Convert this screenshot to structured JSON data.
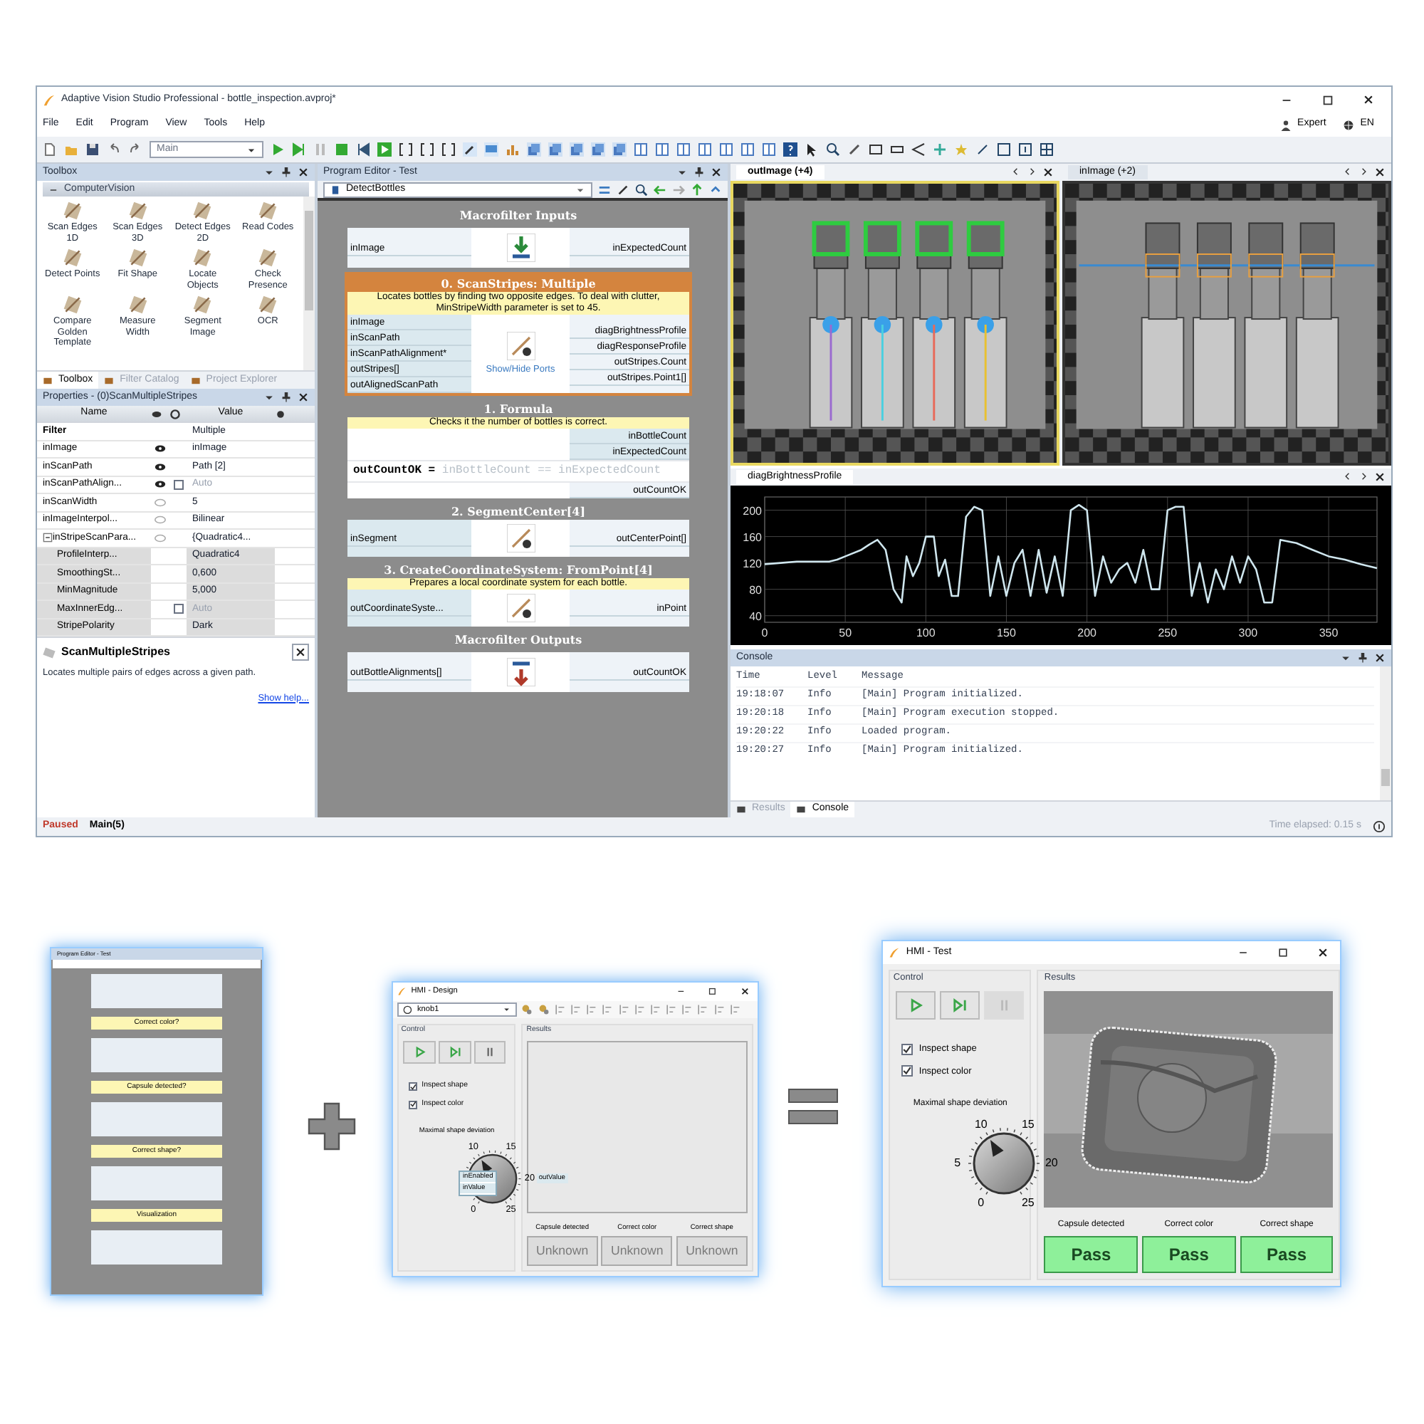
{
  "window": {
    "title": "Adaptive Vision Studio Professional - bottle_inspection.avproj*"
  },
  "menu": [
    "File",
    "Edit",
    "Program",
    "View",
    "Tools",
    "Help"
  ],
  "menu_right": [
    "Expert",
    "EN"
  ],
  "toolbar": {
    "program_select": "Main"
  },
  "toolbox": {
    "title": "Toolbox",
    "category": "ComputerVision",
    "items": [
      "Scan Edges 1D",
      "Scan Edges 3D",
      "Detect Edges 2D",
      "Read Codes",
      "Detect Points",
      "Fit Shape",
      "Locate Objects",
      "Check Presence",
      "Compare Golden Template",
      "Measure Width",
      "Segment Image",
      "OCR"
    ],
    "tabs": [
      {
        "label": "Toolbox",
        "selected": true
      },
      {
        "label": "Filter Catalog",
        "selected": false
      },
      {
        "label": "Project Explorer",
        "selected": false
      }
    ]
  },
  "properties": {
    "title": "Properties - (0)ScanMultipleStripes",
    "columns": [
      "Name",
      "Value"
    ],
    "rows": [
      {
        "name": "Filter",
        "value": "Multiple"
      },
      {
        "name": "inImage",
        "visible": true,
        "value": "inImage"
      },
      {
        "name": "inScanPath",
        "visible": true,
        "value": "Path [2]"
      },
      {
        "name": "inScanPathAlign...",
        "visible": true,
        "checked": false,
        "value": "Auto",
        "disabled": true
      },
      {
        "name": "inScanWidth",
        "visible": false,
        "value": "5"
      },
      {
        "name": "inImageInterpol...",
        "visible": false,
        "value": "Bilinear"
      },
      {
        "name": "inStripeScanPara...",
        "visible": false,
        "value": "{Quadratic4...",
        "expanded": true,
        "children": [
          {
            "name": "ProfileInterp...",
            "value": "Quadratic4"
          },
          {
            "name": "SmoothingSt...",
            "value": "0,600"
          },
          {
            "name": "MinMagnitude",
            "value": "5,000"
          },
          {
            "name": "MaxInnerEdg...",
            "checked": false,
            "value": "Auto",
            "disabled": true
          },
          {
            "name": "StripePolarity",
            "value": "Dark"
          }
        ]
      }
    ]
  },
  "help": {
    "title": "ScanMultipleStripes",
    "text": "Locates multiple pairs of edges across a given path.",
    "link": "Show help..."
  },
  "program_editor": {
    "title": "Program Editor - Test",
    "macrofilter": "DetectBottles",
    "blocks": [
      {
        "kind": "inputs",
        "title": "Macrofilter Inputs",
        "left": [
          "inImage"
        ],
        "right": [
          "inExpectedCount"
        ]
      },
      {
        "kind": "filter",
        "title": "0. ScanStripes: Multiple",
        "selected": true,
        "comment": "Locates bottles by finding two opposite edges. To deal with clutter, MinStripeWidth parameter is set to 45.",
        "left": [
          "inImage",
          "inScanPath",
          "inScanPathAlignment*",
          "outStripes[]",
          "outAlignedScanPath"
        ],
        "center_label": "Show/Hide Ports",
        "right": [
          "diagBrightnessProfile",
          "diagResponseProfile",
          "outStripes.Count",
          "outStripes.Point1[]"
        ]
      },
      {
        "kind": "formula",
        "title": "1. Formula",
        "selected": false,
        "comment": "Checks it the number of bottles is correct.",
        "inputs": [
          "inBottleCount",
          "inExpectedCount"
        ],
        "formula": "**outCountOK =** inBottleCount == inExpectedCount",
        "outputs": [
          "outCountOK"
        ]
      },
      {
        "kind": "filter",
        "title": "2. SegmentCenter[4]",
        "selected": false,
        "left": [
          "inSegment"
        ],
        "right": [
          "outCenterPoint[]"
        ]
      },
      {
        "kind": "filter",
        "title": "3. CreateCoordinateSystem: FromPoint[4]",
        "selected": false,
        "comment": "Prepares a local coordinate system for each bottle.",
        "left": [
          "outCoordinateSyste..."
        ],
        "right": [
          "inPoint"
        ]
      },
      {
        "kind": "outputs",
        "title": "Macrofilter Outputs",
        "left": [
          "outBottleAlignments[]"
        ],
        "right": [
          "outCountOK"
        ]
      }
    ]
  },
  "image_views": [
    {
      "tab": "outImage (+4)",
      "selected": true,
      "overlays": true
    },
    {
      "tab": "inImage (+2)",
      "selected": false,
      "overlays": false
    }
  ],
  "profile_view": {
    "tab": "diagBrightnessProfile",
    "chart_data": {
      "type": "line",
      "x": [
        0,
        10,
        20,
        30,
        40,
        45,
        50,
        60,
        65,
        70,
        75,
        80,
        85,
        88,
        92,
        96,
        100,
        105,
        108,
        112,
        116,
        120,
        125,
        130,
        135,
        140,
        145,
        150,
        155,
        160,
        165,
        170,
        175,
        180,
        185,
        190,
        195,
        200,
        205,
        210,
        215,
        220,
        225,
        230,
        235,
        240,
        245,
        250,
        255,
        260,
        265,
        270,
        275,
        280,
        285,
        290,
        295,
        300,
        305,
        310,
        315,
        320,
        330,
        340,
        350,
        360,
        370,
        380
      ],
      "series": [
        {
          "color": "#cfe6ee",
          "values": [
            118,
            120,
            122,
            122,
            122,
            125,
            130,
            140,
            148,
            155,
            140,
            80,
            60,
            130,
            100,
            120,
            160,
            160,
            100,
            125,
            70,
            70,
            190,
            205,
            200,
            70,
            130,
            70,
            120,
            140,
            70,
            140,
            75,
            130,
            70,
            200,
            208,
            200,
            70,
            130,
            90,
            110,
            120,
            90,
            140,
            80,
            80,
            200,
            205,
            205,
            70,
            120,
            60,
            110,
            80,
            130,
            90,
            130,
            110,
            60,
            60,
            155,
            150,
            140,
            130,
            125,
            118,
            112
          ]
        }
      ],
      "xlim": [
        0,
        380
      ],
      "ylim": [
        30,
        220
      ],
      "grid": true,
      "xticks": [
        0,
        50,
        100,
        150,
        200,
        250,
        300,
        350
      ],
      "yticks": [
        40,
        80,
        120,
        160,
        200
      ]
    }
  },
  "console": {
    "title": "Console",
    "columns": [
      "Time",
      "Level",
      "Message"
    ],
    "rows": [
      [
        "19:18:07",
        "Info",
        "[Main] Program initialized."
      ],
      [
        "19:20:18",
        "Info",
        "[Main] Program execution stopped."
      ],
      [
        "19:20:22",
        "Info",
        "Loaded program."
      ],
      [
        "19:20:27",
        "Info",
        "[Main] Program initialized."
      ]
    ],
    "tabs": [
      {
        "label": "Results",
        "selected": false
      },
      {
        "label": "Console",
        "selected": true
      }
    ]
  },
  "status_bar": {
    "state": "Paused",
    "program": "Main(5)",
    "time": "Time elapsed: 0.15 s"
  },
  "thumbnail_editor": {
    "title": "Program Editor - Test",
    "comments": [
      "Correct color?",
      "Capsule detected?",
      "Correct shape?",
      "Visualization"
    ]
  },
  "hmi_windows": [
    {
      "kind": "design",
      "title": "HMI - Design",
      "selector": "knob1",
      "control_label": "Control",
      "results_label": "Results",
      "buttons": [
        {
          "kind": "play",
          "disabled": false
        },
        {
          "kind": "step",
          "disabled": false
        },
        {
          "kind": "pause",
          "disabled": false
        }
      ],
      "checkboxes": [
        {
          "label": "Inspect shape",
          "checked": true
        },
        {
          "label": "Inspect color",
          "checked": true
        }
      ],
      "knob": {
        "caption": "Maximal shape deviation",
        "labels": [
          "0",
          "10",
          "15",
          "20",
          "25"
        ],
        "level": 0.4,
        "ports_in": [
          "inEnabled",
          "inValue"
        ],
        "port_out": "outValue"
      },
      "indicators": [
        {
          "caption": "Capsule detected",
          "value": "Unknown",
          "kind": "unknown"
        },
        {
          "caption": "Correct color",
          "value": "Unknown",
          "kind": "unknown"
        },
        {
          "caption": "Correct shape",
          "value": "Unknown",
          "kind": "unknown"
        }
      ]
    },
    {
      "kind": "test",
      "title": "HMI - Test",
      "control_label": "Control",
      "results_label": "Results",
      "buttons": [
        {
          "kind": "play",
          "disabled": false
        },
        {
          "kind": "step",
          "disabled": false
        },
        {
          "kind": "pause",
          "disabled": true
        }
      ],
      "checkboxes": [
        {
          "label": "Inspect shape",
          "checked": true
        },
        {
          "label": "Inspect color",
          "checked": true
        }
      ],
      "knob": {
        "caption": "Maximal shape deviation",
        "labels": [
          "0",
          "5",
          "10",
          "15",
          "20",
          "25"
        ],
        "level": 0.4
      },
      "indicators": [
        {
          "caption": "Capsule detected",
          "value": "Pass",
          "kind": "pass"
        },
        {
          "caption": "Correct color",
          "value": "Pass",
          "kind": "pass"
        },
        {
          "caption": "Correct shape",
          "value": "Pass",
          "kind": "pass"
        }
      ]
    }
  ]
}
